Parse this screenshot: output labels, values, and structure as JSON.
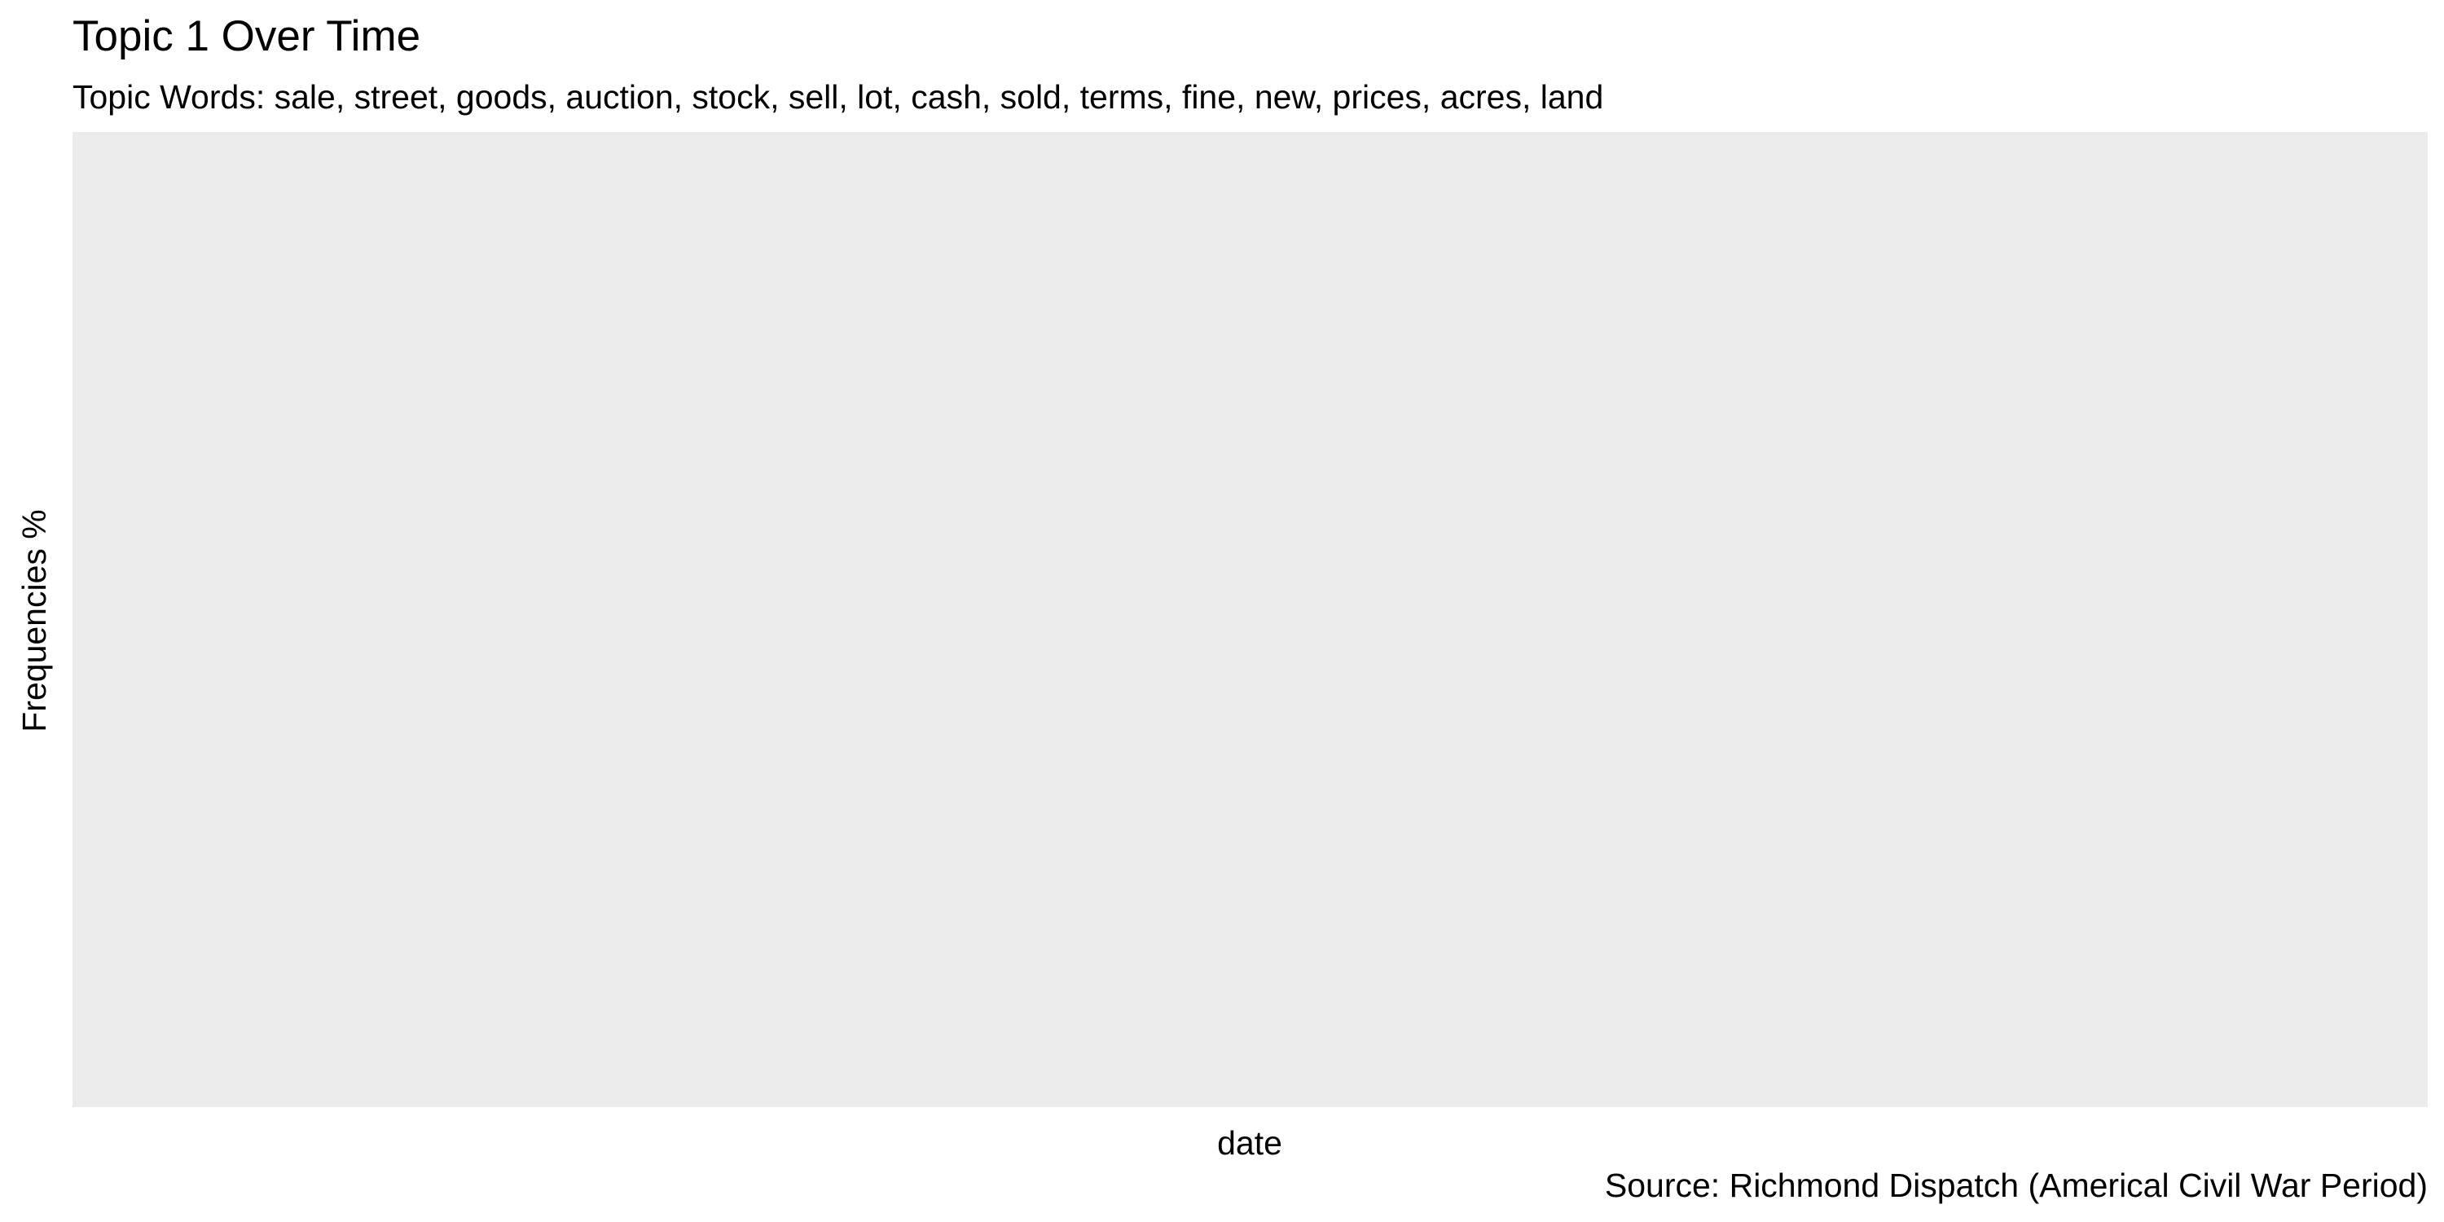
{
  "chart_data": {
    "type": "line",
    "title": "Topic 1 Over Time",
    "subtitle": "Topic Words: sale, street, goods, auction, stock, sell, lot, cash, sold, terms, fine, new, prices, acres, land",
    "xlabel": "date",
    "ylabel": "Frequencies %",
    "caption": "Source: Richmond Dispatch (Americal Civil War Period)",
    "x": [],
    "series": [],
    "grid": false,
    "legend": "none",
    "colors": {
      "panel_background": "#EBEBEB",
      "text": "#000000"
    }
  }
}
